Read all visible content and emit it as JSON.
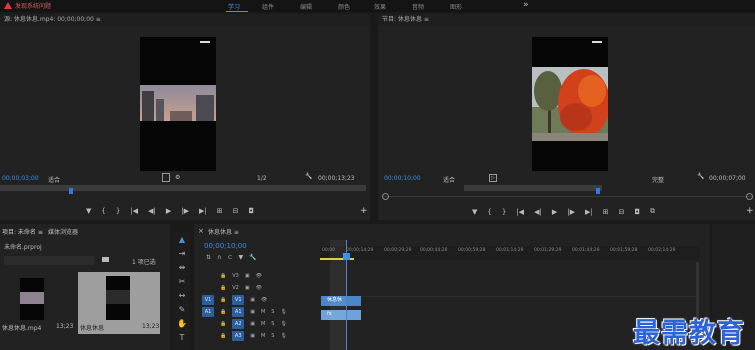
{
  "topbar": {
    "warning_text": "发现系统问题",
    "workspaces": [
      "学习",
      "组件",
      "编辑",
      "颜色",
      "效果",
      "音频",
      "图形"
    ],
    "active_workspace": 0,
    "more": "»"
  },
  "source_monitor": {
    "title": "源: 休息休息.mp4: 00;00;00;00  ≡",
    "timecode_left": "00;00;03;00",
    "fit_label": "适合",
    "page_label": "1/2",
    "timecode_right": "00;00;13;23"
  },
  "program_monitor": {
    "title": "节目: 休息休息  ≡",
    "timecode_left": "00;00;10;00",
    "fit_label": "适合",
    "full_label": "完整",
    "timecode_right": "00;00;07;00"
  },
  "project": {
    "tab1": "项目: 未命名  ≡",
    "tab2": "媒体浏览器",
    "file": "未命名.prproj",
    "count_label": "1 项已选",
    "items": [
      {
        "name": "休息休息.mp4",
        "duration": "13;23"
      },
      {
        "name": "休息休息",
        "duration": "13;23"
      }
    ]
  },
  "timeline": {
    "title": "休息休息  ≡",
    "timecode": "00;00;10;00",
    "ruler": [
      "00;00",
      "00;00;14;29",
      "00;00;29;29",
      "00;00;44;28",
      "00;00;59;28",
      "00;01;14;29",
      "00;01;29;29",
      "00;01;44;29",
      "00;01;59;28",
      "00;02;14;29"
    ],
    "tracks": [
      {
        "label": "V3",
        "target": "",
        "active": false
      },
      {
        "label": "V2",
        "target": "",
        "active": false
      },
      {
        "label": "V1",
        "target": "V1",
        "active": true
      },
      {
        "label": "A1",
        "target": "A1",
        "active": true
      },
      {
        "label": "A2",
        "target": "",
        "active": true
      },
      {
        "label": "A3",
        "target": "",
        "active": true
      }
    ],
    "video_clip": "休息休",
    "audio_clip": "fx"
  },
  "watermark": "最需教育",
  "colors": {
    "accent": "#3a8fe8",
    "panel": "#222222",
    "background": "#1a1a1a",
    "warning": "#e03b3b",
    "watermark": "#2d63d9"
  }
}
